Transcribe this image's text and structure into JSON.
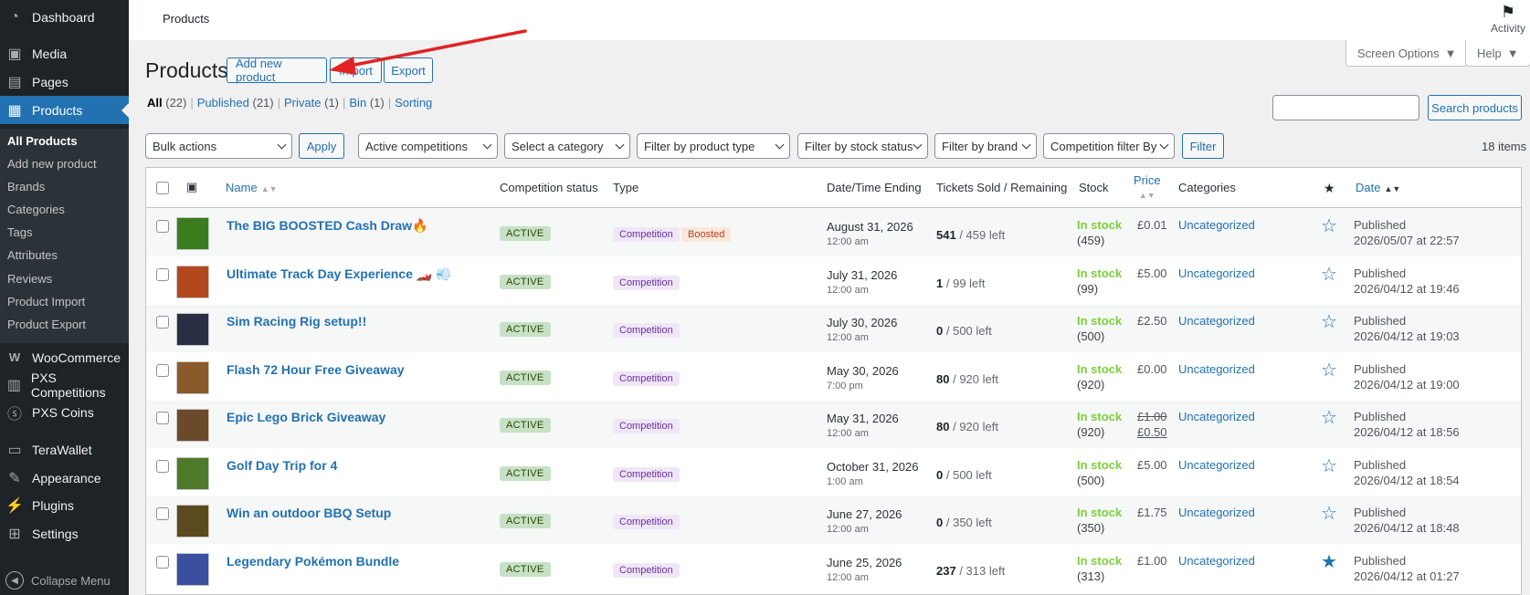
{
  "sidebar": {
    "items": [
      {
        "label": "Dashboard",
        "icon": "dashboard-icon"
      },
      {
        "label": "Media",
        "icon": "media-icon"
      },
      {
        "label": "Pages",
        "icon": "pages-icon"
      },
      {
        "label": "Products",
        "icon": "products-icon"
      },
      {
        "label": "WooCommerce",
        "icon": "woocommerce-icon"
      },
      {
        "label": "PXS Competitions",
        "icon": "competitions-icon"
      },
      {
        "label": "PXS Coins",
        "icon": "coins-icon"
      },
      {
        "label": "TeraWallet",
        "icon": "wallet-icon"
      },
      {
        "label": "Appearance",
        "icon": "appearance-icon"
      },
      {
        "label": "Plugins",
        "icon": "plugins-icon"
      },
      {
        "label": "Settings",
        "icon": "settings-icon"
      }
    ],
    "submenu": [
      "All Products",
      "Add new product",
      "Brands",
      "Categories",
      "Tags",
      "Attributes",
      "Reviews",
      "Product Import",
      "Product Export"
    ],
    "collapse_label": "Collapse Menu"
  },
  "topbar": {
    "title": "Products",
    "activity_label": "Activity"
  },
  "screen_options": "Screen Options",
  "help": "Help",
  "page": {
    "heading": "Products",
    "add_new": "Add new product",
    "import": "Import",
    "export": "Export"
  },
  "views": {
    "all": "All",
    "all_count": "(22)",
    "published": "Published",
    "published_count": "(21)",
    "private": "Private",
    "private_count": "(1)",
    "bin": "Bin",
    "bin_count": "(1)",
    "sorting": "Sorting",
    "sep": "|"
  },
  "search": {
    "button": "Search products",
    "value": ""
  },
  "filters": {
    "bulk": "Bulk actions",
    "apply": "Apply",
    "competitions": "Active competitions",
    "category": "Select a category",
    "product_type": "Filter by product type",
    "stock_status": "Filter by stock status",
    "brand": "Filter by brand",
    "competition_filter": "Competition filter By",
    "filter": "Filter"
  },
  "items_count": "18 items",
  "columns": {
    "name": "Name",
    "competition_status": "Competition status",
    "type": "Type",
    "date_ending": "Date/Time Ending",
    "tickets": "Tickets Sold / Remaining",
    "stock": "Stock",
    "price": "Price",
    "categories": "Categories",
    "date": "Date"
  },
  "rows": [
    {
      "name": "The BIG BOOSTED Cash Draw🔥",
      "status": "ACTIVE",
      "type": "Competition",
      "boosted": "Boosted",
      "date": "August 31, 2026",
      "time": "12:00 am",
      "sold": "541",
      "remaining": "/ 459 left",
      "stock": "In stock",
      "stock_qty": "(459)",
      "price": "£0.01",
      "sale": "",
      "category": "Uncategorized",
      "featured": false,
      "pub": "Published",
      "pub_date": "2026/05/07 at 22:57",
      "thumb_color": "#3a7d1e"
    },
    {
      "name": "Ultimate Track Day Experience 🏎️ 💨",
      "status": "ACTIVE",
      "type": "Competition",
      "boosted": "",
      "date": "July 31, 2026",
      "time": "12:00 am",
      "sold": "1",
      "remaining": "/ 99 left",
      "stock": "In stock",
      "stock_qty": "(99)",
      "price": "£5.00",
      "sale": "",
      "category": "Uncategorized",
      "featured": false,
      "pub": "Published",
      "pub_date": "2026/04/12 at 19:46",
      "thumb_color": "#b3481d"
    },
    {
      "name": "Sim Racing Rig setup!!",
      "status": "ACTIVE",
      "type": "Competition",
      "boosted": "",
      "date": "July 30, 2026",
      "time": "12:00 am",
      "sold": "0",
      "remaining": "/ 500 left",
      "stock": "In stock",
      "stock_qty": "(500)",
      "price": "£2.50",
      "sale": "",
      "category": "Uncategorized",
      "featured": false,
      "pub": "Published",
      "pub_date": "2026/04/12 at 19:03",
      "thumb_color": "#2a2f44"
    },
    {
      "name": "Flash 72 Hour Free Giveaway",
      "status": "ACTIVE",
      "type": "Competition",
      "boosted": "",
      "date": "May 30, 2026",
      "time": "7:00 pm",
      "sold": "80",
      "remaining": "/ 920 left",
      "stock": "In stock",
      "stock_qty": "(920)",
      "price": "£0.00",
      "sale": "",
      "category": "Uncategorized",
      "featured": false,
      "pub": "Published",
      "pub_date": "2026/04/12 at 19:00",
      "thumb_color": "#8a5a2b"
    },
    {
      "name": "Epic Lego Brick Giveaway",
      "status": "ACTIVE",
      "type": "Competition",
      "boosted": "",
      "date": "May 31, 2026",
      "time": "12:00 am",
      "sold": "80",
      "remaining": "/ 920 left",
      "stock": "In stock",
      "stock_qty": "(920)",
      "price": "£1.00",
      "sale": "£0.50",
      "category": "Uncategorized",
      "featured": false,
      "pub": "Published",
      "pub_date": "2026/04/12 at 18:56",
      "thumb_color": "#6b4a2a"
    },
    {
      "name": "Golf Day Trip for 4",
      "status": "ACTIVE",
      "type": "Competition",
      "boosted": "",
      "date": "October 31, 2026",
      "time": "1:00 am",
      "sold": "0",
      "remaining": "/ 500 left",
      "stock": "In stock",
      "stock_qty": "(500)",
      "price": "£5.00",
      "sale": "",
      "category": "Uncategorized",
      "featured": false,
      "pub": "Published",
      "pub_date": "2026/04/12 at 18:54",
      "thumb_color": "#4f7a2a"
    },
    {
      "name": "Win an outdoor BBQ Setup",
      "status": "ACTIVE",
      "type": "Competition",
      "boosted": "",
      "date": "June 27, 2026",
      "time": "12:00 am",
      "sold": "0",
      "remaining": "/ 350 left",
      "stock": "In stock",
      "stock_qty": "(350)",
      "price": "£1.75",
      "sale": "",
      "category": "Uncategorized",
      "featured": false,
      "pub": "Published",
      "pub_date": "2026/04/12 at 18:48",
      "thumb_color": "#5a4a1e"
    },
    {
      "name": "Legendary Pokémon Bundle",
      "status": "ACTIVE",
      "type": "Competition",
      "boosted": "",
      "date": "June 25, 2026",
      "time": "12:00 am",
      "sold": "237",
      "remaining": "/ 313 left",
      "stock": "In stock",
      "stock_qty": "(313)",
      "price": "£1.00",
      "sale": "",
      "category": "Uncategorized",
      "featured": true,
      "pub": "Published",
      "pub_date": "2026/04/12 at 01:27",
      "thumb_color": "#3a4fa0"
    }
  ],
  "colors": {
    "accent": "#2271b1",
    "sidebar": "#1d2327",
    "annotation": "#e02424"
  }
}
